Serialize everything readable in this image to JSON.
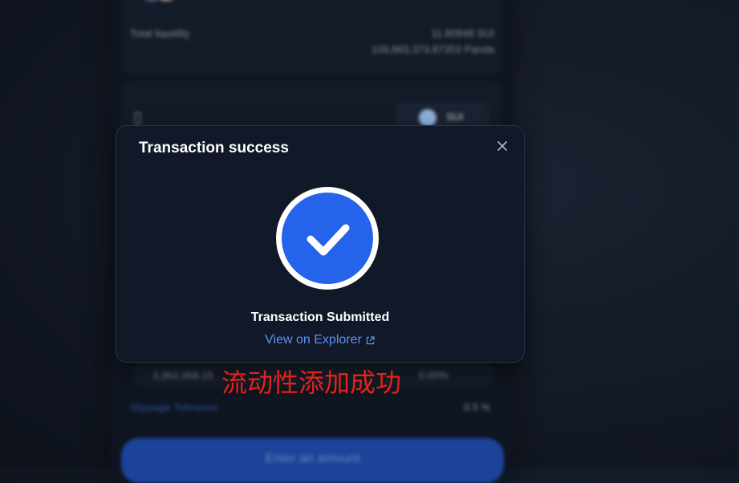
{
  "background": {
    "total_liquidity_label": "Total liquidity",
    "total_liquidity_value_1": "11.80848 SUI",
    "total_liquidity_value_2": "109,883,373.87353 Panda",
    "token_select_label": "SUI",
    "row_value_1": "3,362,066.15",
    "row_value_2": "0.00%",
    "slippage_label": "Slippage Tolerance",
    "slippage_value": "0.5 %",
    "main_button_label": "Enter an amount"
  },
  "modal": {
    "title": "Transaction success",
    "status_text": "Transaction Submitted",
    "explorer_link_label": "View on Explorer"
  },
  "annotation": {
    "text": "流动性添加成功"
  },
  "colors": {
    "accent": "#2563eb",
    "link": "#5b93f5",
    "annotation": "#e62117"
  },
  "icons": {
    "close": "close-icon",
    "success": "checkmark-icon",
    "external": "external-link-icon"
  }
}
